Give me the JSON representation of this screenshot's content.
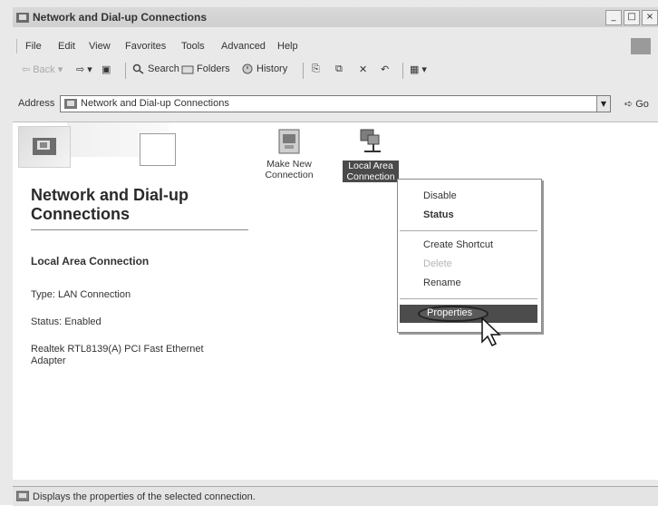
{
  "window": {
    "title": "Network and Dial-up Connections",
    "controls": [
      "_",
      "□",
      "×"
    ]
  },
  "menubar": {
    "items": [
      "File",
      "Edit",
      "View",
      "Favorites",
      "Tools",
      "Advanced",
      "Help"
    ]
  },
  "toolbar": {
    "back": "Back",
    "search": "Search",
    "folders": "Folders",
    "history": "History"
  },
  "address": {
    "label": "Address",
    "value": "Network and Dial-up Connections",
    "go": "Go"
  },
  "left_panel": {
    "title": "Network and Dial-up Connections",
    "selected_name": "Local Area Connection",
    "type": "Type: LAN Connection",
    "status": "Status: Enabled",
    "adapter": "Realtek RTL8139(A) PCI Fast Ethernet Adapter"
  },
  "connections": [
    {
      "label": "Make New Connection",
      "icon": "make-new-connection-icon"
    },
    {
      "label": "Local Area Connection",
      "icon": "local-area-connection-icon",
      "selected": true
    }
  ],
  "context_menu": {
    "items": [
      {
        "label": "Disable"
      },
      {
        "label": "Status",
        "bold": true
      },
      {
        "label": "Create Shortcut"
      },
      {
        "label": "Delete",
        "disabled": true
      },
      {
        "label": "Rename"
      },
      {
        "label": "Properties",
        "highlighted": true
      }
    ]
  },
  "statusbar": {
    "text": "Displays the properties of the selected connection."
  }
}
